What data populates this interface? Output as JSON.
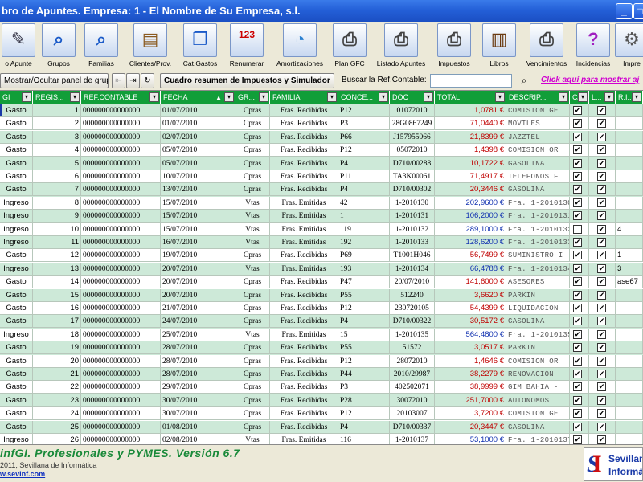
{
  "window": {
    "title": "bro de Apuntes. Empresa: 1 - El Nombre de Su Empresa, s.l."
  },
  "toolbar": {
    "items": [
      {
        "label": "o Apunte",
        "icon": "notebook-icon"
      },
      {
        "label": "Grupos",
        "icon": "magnifier-icon"
      },
      {
        "label": "Familias",
        "icon": "magnifier-icon"
      },
      {
        "label": "Clientes/Prov.",
        "icon": "card-file-icon"
      },
      {
        "label": "Cat.Gastos",
        "icon": "book-icon"
      },
      {
        "label": "Renumerar",
        "icon": "calendar-icon"
      },
      {
        "label": "Amortizaciones",
        "icon": "pie-chart-icon"
      },
      {
        "label": "Plan GFC",
        "icon": "printer-icon"
      },
      {
        "label": "Listado Apuntes",
        "icon": "printer-icon"
      },
      {
        "label": "Impuestos",
        "icon": "printer-icon"
      },
      {
        "label": "Libros",
        "icon": "books-icon"
      },
      {
        "label": "Vencimientos",
        "icon": "printer-icon"
      },
      {
        "label": "Incidencias",
        "icon": "help-book-icon"
      },
      {
        "label": "Impre",
        "icon": "wrench-icon"
      }
    ]
  },
  "toolbar2": {
    "toggle_panel_label": "Mostrar/Ocultar panel de grupos",
    "summary_label": "Cuadro resumen de Impuestos y Simulador",
    "search_label": "Buscar la Ref.Contable:",
    "search_value": "",
    "show_link": "Click aquí para mostrar aj"
  },
  "grid": {
    "columns": [
      "GI",
      "REGIS...",
      "REF.CONTABLE",
      "FECHA",
      "GR...",
      "FAMILIA",
      "CONCE...",
      "DOC",
      "TOTAL",
      "DESCRIP...",
      "C/I",
      "L...",
      "R.I..."
    ],
    "rows": [
      {
        "tipo": "Gasto",
        "reg": "1",
        "ref": "000000000000000",
        "fecha": "01/07/2010",
        "gr": "Cpras",
        "familia": "Fras. Recibidas",
        "conce": "P12",
        "doc": "01072010",
        "total": "1,0781 €",
        "desc": "COMISION GE",
        "ci": true,
        "l": true,
        "ri": ""
      },
      {
        "tipo": "Gasto",
        "reg": "2",
        "ref": "000000000000000",
        "fecha": "01/07/2010",
        "gr": "Cpras",
        "familia": "Fras. Recibidas",
        "conce": "P3",
        "doc": "28G0867249",
        "total": "71,0440 €",
        "desc": "MOVILES",
        "ci": true,
        "l": true,
        "ri": ""
      },
      {
        "tipo": "Gasto",
        "reg": "3",
        "ref": "000000000000000",
        "fecha": "02/07/2010",
        "gr": "Cpras",
        "familia": "Fras. Recibidas",
        "conce": "P66",
        "doc": "J157955066",
        "total": "21,8399 €",
        "desc": "JAZZTEL",
        "ci": true,
        "l": true,
        "ri": ""
      },
      {
        "tipo": "Gasto",
        "reg": "4",
        "ref": "000000000000000",
        "fecha": "05/07/2010",
        "gr": "Cpras",
        "familia": "Fras. Recibidas",
        "conce": "P12",
        "doc": "05072010",
        "total": "1,4398 €",
        "desc": "COMISION OR",
        "ci": true,
        "l": true,
        "ri": ""
      },
      {
        "tipo": "Gasto",
        "reg": "5",
        "ref": "000000000000000",
        "fecha": "05/07/2010",
        "gr": "Cpras",
        "familia": "Fras. Recibidas",
        "conce": "P4",
        "doc": "D710/00288",
        "total": "10,1722 €",
        "desc": "GASOLINA",
        "ci": true,
        "l": true,
        "ri": ""
      },
      {
        "tipo": "Gasto",
        "reg": "6",
        "ref": "000000000000000",
        "fecha": "10/07/2010",
        "gr": "Cpras",
        "familia": "Fras. Recibidas",
        "conce": "P11",
        "doc": "TA3K00061",
        "total": "71,4917 €",
        "desc": "TELEFONOS F",
        "ci": true,
        "l": true,
        "ri": ""
      },
      {
        "tipo": "Gasto",
        "reg": "7",
        "ref": "000000000000000",
        "fecha": "13/07/2010",
        "gr": "Cpras",
        "familia": "Fras. Recibidas",
        "conce": "P4",
        "doc": "D710/00302",
        "total": "20,3446 €",
        "desc": "GASOLINA",
        "ci": true,
        "l": true,
        "ri": ""
      },
      {
        "tipo": "Ingreso",
        "reg": "8",
        "ref": "000000000000000",
        "fecha": "15/07/2010",
        "gr": "Vtas",
        "familia": "Fras. Emitidas",
        "conce": "42",
        "doc": "1-2010130",
        "total": "202,9600 €",
        "desc": "Fra. 1-2010130",
        "ci": true,
        "l": true,
        "ri": ""
      },
      {
        "tipo": "Ingreso",
        "reg": "9",
        "ref": "000000000000000",
        "fecha": "15/07/2010",
        "gr": "Vtas",
        "familia": "Fras. Emitidas",
        "conce": "1",
        "doc": "1-2010131",
        "total": "106,2000 €",
        "desc": "Fra. 1-2010131",
        "ci": true,
        "l": true,
        "ri": ""
      },
      {
        "tipo": "Ingreso",
        "reg": "10",
        "ref": "000000000000000",
        "fecha": "15/07/2010",
        "gr": "Vtas",
        "familia": "Fras. Emitidas",
        "conce": "119",
        "doc": "1-2010132",
        "total": "289,1000 €",
        "desc": "Fra. 1-2010132",
        "ci": false,
        "l": true,
        "ri": "4"
      },
      {
        "tipo": "Ingreso",
        "reg": "11",
        "ref": "000000000000000",
        "fecha": "16/07/2010",
        "gr": "Vtas",
        "familia": "Fras. Emitidas",
        "conce": "192",
        "doc": "1-2010133",
        "total": "128,6200 €",
        "desc": "Fra. 1-2010133",
        "ci": true,
        "l": true,
        "ri": ""
      },
      {
        "tipo": "Gasto",
        "reg": "12",
        "ref": "000000000000000",
        "fecha": "19/07/2010",
        "gr": "Cpras",
        "familia": "Fras. Recibidas",
        "conce": "P69",
        "doc": "T1001H046",
        "total": "56,7499 €",
        "desc": "SUMINISTRO I",
        "ci": true,
        "l": true,
        "ri": "1"
      },
      {
        "tipo": "Ingreso",
        "reg": "13",
        "ref": "000000000000000",
        "fecha": "20/07/2010",
        "gr": "Vtas",
        "familia": "Fras. Emitidas",
        "conce": "193",
        "doc": "1-2010134",
        "total": "66,4788 €",
        "desc": "Fra. 1-2010134",
        "ci": true,
        "l": true,
        "ri": "3"
      },
      {
        "tipo": "Gasto",
        "reg": "14",
        "ref": "000000000000000",
        "fecha": "20/07/2010",
        "gr": "Cpras",
        "familia": "Fras. Recibidas",
        "conce": "P47",
        "doc": "20/07/2010",
        "total": "141,6000 €",
        "desc": "ASESORES",
        "ci": true,
        "l": true,
        "ri": "ase67"
      },
      {
        "tipo": "Gasto",
        "reg": "15",
        "ref": "000000000000000",
        "fecha": "20/07/2010",
        "gr": "Cpras",
        "familia": "Fras. Recibidas",
        "conce": "P55",
        "doc": "512240",
        "total": "3,6620 €",
        "desc": "PARKIN",
        "ci": true,
        "l": true,
        "ri": ""
      },
      {
        "tipo": "Gasto",
        "reg": "16",
        "ref": "000000000000000",
        "fecha": "21/07/2010",
        "gr": "Cpras",
        "familia": "Fras. Recibidas",
        "conce": "P12",
        "doc": "230720105",
        "total": "54,4399 €",
        "desc": "LIQUIDACION",
        "ci": true,
        "l": true,
        "ri": ""
      },
      {
        "tipo": "Gasto",
        "reg": "17",
        "ref": "000000000000000",
        "fecha": "24/07/2010",
        "gr": "Cpras",
        "familia": "Fras. Recibidas",
        "conce": "P4",
        "doc": "D710/00322",
        "total": "30,5172 €",
        "desc": "GASOLINA",
        "ci": true,
        "l": true,
        "ri": ""
      },
      {
        "tipo": "Ingreso",
        "reg": "18",
        "ref": "000000000000000",
        "fecha": "25/07/2010",
        "gr": "Vtas",
        "familia": "Fras. Emitidas",
        "conce": "15",
        "doc": "1-2010135",
        "total": "564,4800 €",
        "desc": "Fra. 1-2010135",
        "ci": true,
        "l": true,
        "ri": ""
      },
      {
        "tipo": "Gasto",
        "reg": "19",
        "ref": "000000000000000",
        "fecha": "28/07/2010",
        "gr": "Cpras",
        "familia": "Fras. Recibidas",
        "conce": "P55",
        "doc": "51572",
        "total": "3,0517 €",
        "desc": "PARKIN",
        "ci": true,
        "l": true,
        "ri": ""
      },
      {
        "tipo": "Gasto",
        "reg": "20",
        "ref": "000000000000000",
        "fecha": "28/07/2010",
        "gr": "Cpras",
        "familia": "Fras. Recibidas",
        "conce": "P12",
        "doc": "28072010",
        "total": "1,4646 €",
        "desc": "COMISION OR",
        "ci": true,
        "l": true,
        "ri": ""
      },
      {
        "tipo": "Gasto",
        "reg": "21",
        "ref": "000000000000000",
        "fecha": "28/07/2010",
        "gr": "Cpras",
        "familia": "Fras. Recibidas",
        "conce": "P44",
        "doc": "2010/29987",
        "total": "38,2279 €",
        "desc": "RENOVACIÓN",
        "ci": true,
        "l": true,
        "ri": ""
      },
      {
        "tipo": "Gasto",
        "reg": "22",
        "ref": "000000000000000",
        "fecha": "29/07/2010",
        "gr": "Cpras",
        "familia": "Fras. Recibidas",
        "conce": "P3",
        "doc": "402502071",
        "total": "38,9999 €",
        "desc": "GIM BAHIA -",
        "ci": true,
        "l": true,
        "ri": ""
      },
      {
        "tipo": "Gasto",
        "reg": "23",
        "ref": "000000000000000",
        "fecha": "30/07/2010",
        "gr": "Cpras",
        "familia": "Fras. Recibidas",
        "conce": "P28",
        "doc": "30072010",
        "total": "251,7000 €",
        "desc": "AUTONOMOS",
        "ci": true,
        "l": true,
        "ri": ""
      },
      {
        "tipo": "Gasto",
        "reg": "24",
        "ref": "000000000000000",
        "fecha": "30/07/2010",
        "gr": "Cpras",
        "familia": "Fras. Recibidas",
        "conce": "P12",
        "doc": "20103007",
        "total": "3,7200 €",
        "desc": "COMISION GE",
        "ci": true,
        "l": true,
        "ri": ""
      },
      {
        "tipo": "Gasto",
        "reg": "25",
        "ref": "000000000000000",
        "fecha": "01/08/2010",
        "gr": "Cpras",
        "familia": "Fras. Recibidas",
        "conce": "P4",
        "doc": "D710/00337",
        "total": "20,3447 €",
        "desc": "GASOLINA",
        "ci": true,
        "l": true,
        "ri": ""
      },
      {
        "tipo": "Ingreso",
        "reg": "26",
        "ref": "000000000000000",
        "fecha": "02/08/2010",
        "gr": "Vtas",
        "familia": "Fras. Emitidas",
        "conce": "116",
        "doc": "1-2010137",
        "total": "53,1000 €",
        "desc": "Fra. 1-2010137",
        "ci": true,
        "l": true,
        "ri": ""
      }
    ]
  },
  "footer": {
    "title": "infGI. Profesionales y PYMES. Versión 6.7",
    "copyright": "2011, Sevillana de Informática",
    "url": "w.sevinf.com"
  },
  "logo": {
    "line1": "Sevillan",
    "line2": "Informátic"
  },
  "colors": {
    "header_green": "#119e39",
    "row_alt": "#cde9d8",
    "total_red": "#c00000",
    "total_blue": "#1030b0",
    "title_blue": "#2460d8"
  }
}
